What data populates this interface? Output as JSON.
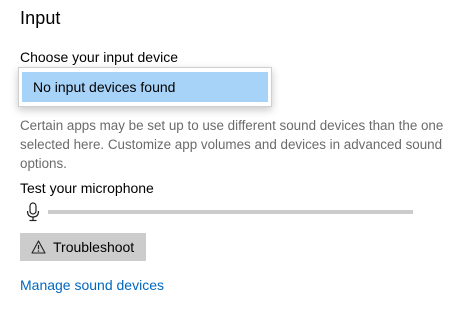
{
  "section": {
    "title": "Input"
  },
  "device": {
    "label": "Choose your input device",
    "dropdown_option": "No input devices found"
  },
  "description": "Certain apps may be set up to use different sound devices than the one selected here. Customize app volumes and devices in advanced sound options.",
  "test": {
    "label": "Test your microphone",
    "icon": "microphone-icon",
    "level": 0
  },
  "troubleshoot": {
    "label": "Troubleshoot",
    "icon": "warning-icon"
  },
  "manage_link": "Manage sound devices",
  "colors": {
    "accent": "#0067c0",
    "selection": "#a8d3f8",
    "button_bg": "#cccccc",
    "secondary_text": "#6b6b6b",
    "level_track": "#cccccc"
  }
}
